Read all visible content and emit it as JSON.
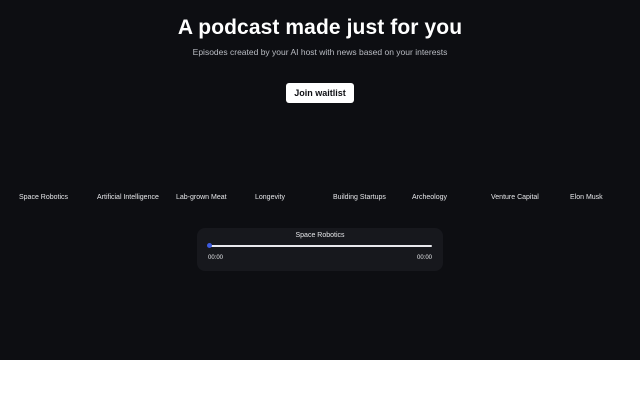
{
  "hero": {
    "title": "A podcast made just for you",
    "subtitle": "Episodes created by your AI host with news based on your interests"
  },
  "cta": {
    "label": "Join waitlist"
  },
  "topics": [
    "Space Robotics",
    "Artificial Intelligence",
    "Lab-grown Meat",
    "Longevity",
    "Building Startups",
    "Archeology",
    "Venture Capital",
    "Elon Musk"
  ],
  "player": {
    "title": "Space Robotics",
    "current_time": "00:00",
    "total_time": "00:00",
    "progress": 0
  },
  "colors": {
    "background": "#0d0e12",
    "player_background": "#17181d",
    "accent": "#3d5bdf",
    "button_background": "#ffffff"
  }
}
